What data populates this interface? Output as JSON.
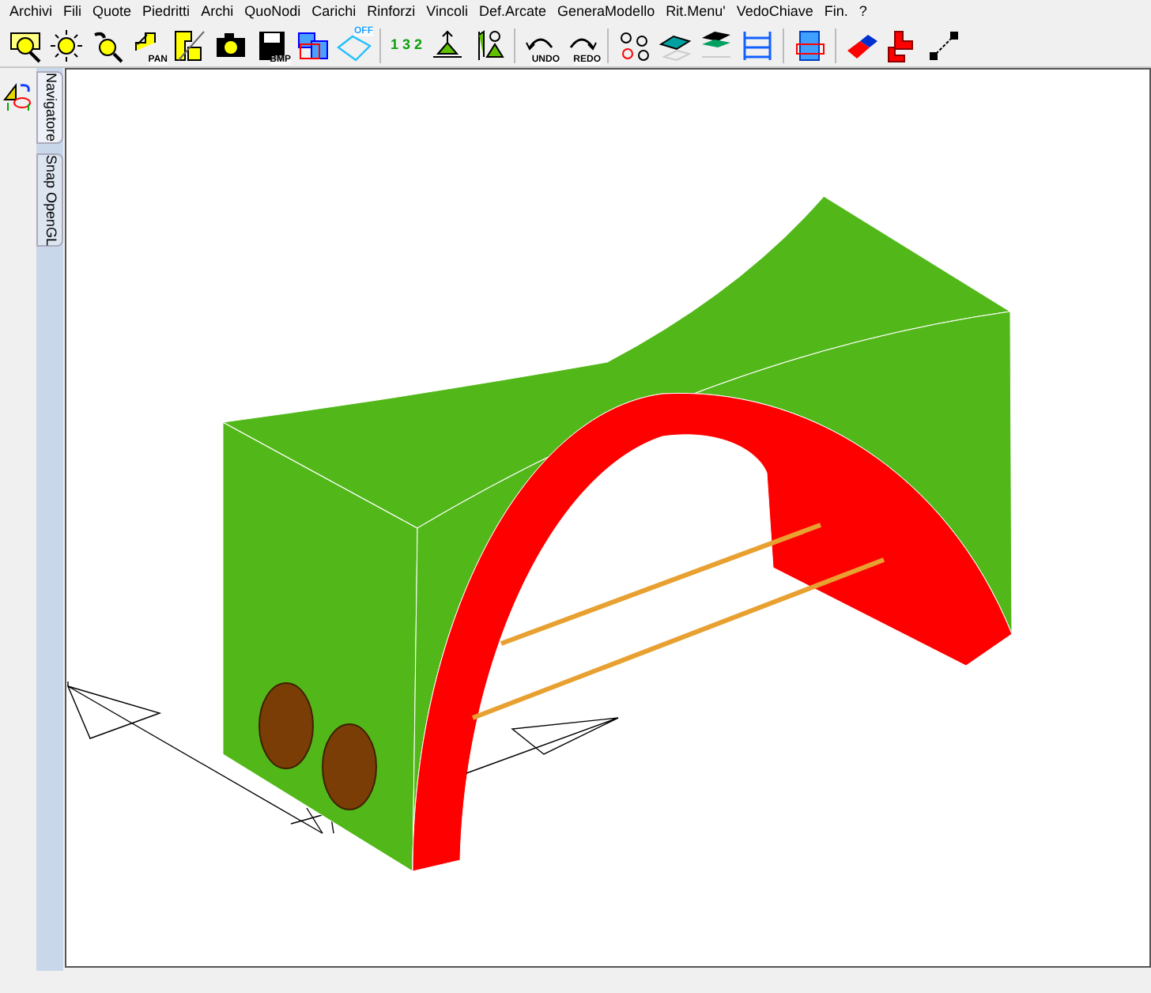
{
  "menu": [
    "Archivi",
    "Fili",
    "Quote",
    "Piedritti",
    "Archi",
    "QuoNodi",
    "Carichi",
    "Rinforzi",
    "Vincoli",
    "Def.Arcate",
    "GeneraModello",
    "Rit.Menu'",
    "VedoChiave",
    "Fin.",
    "?"
  ],
  "toolbar": [
    {
      "kind": "zoom-window"
    },
    {
      "kind": "light"
    },
    {
      "kind": "zoom"
    },
    {
      "kind": "pan",
      "label": "PAN"
    },
    {
      "kind": "section"
    },
    {
      "kind": "camera"
    },
    {
      "kind": "save",
      "label": "BMP"
    },
    {
      "kind": "frame"
    },
    {
      "kind": "off",
      "label": "OFF"
    },
    {
      "kind": "sep"
    },
    {
      "kind": "numbers",
      "label": "1 3 2"
    },
    {
      "kind": "support"
    },
    {
      "kind": "support2"
    },
    {
      "kind": "sep"
    },
    {
      "kind": "undo",
      "label": "UNDO"
    },
    {
      "kind": "redo",
      "label": "REDO"
    },
    {
      "kind": "sep"
    },
    {
      "kind": "nodes"
    },
    {
      "kind": "layer"
    },
    {
      "kind": "layers"
    },
    {
      "kind": "ladder"
    },
    {
      "kind": "sep"
    },
    {
      "kind": "building"
    },
    {
      "kind": "sep"
    },
    {
      "kind": "eraser"
    },
    {
      "kind": "corner"
    },
    {
      "kind": "dimension"
    }
  ],
  "side_tabs": [
    {
      "label": "Navigatore",
      "selected": true
    },
    {
      "label": "Snap OpenGL",
      "selected": false
    }
  ]
}
